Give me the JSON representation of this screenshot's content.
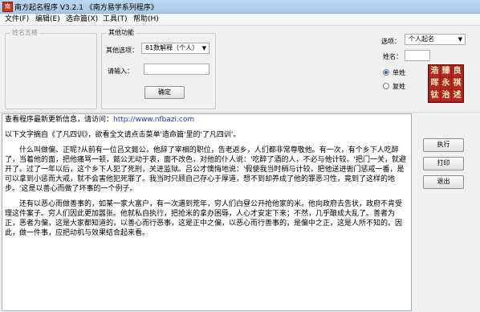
{
  "window": {
    "title": "南方起名程序 V3.2.1  《南方易学系列程序》"
  },
  "menu": {
    "items": [
      "文件(F)",
      "编辑(E)",
      "选命篇(X)",
      "工具(T)",
      "帮助(H)"
    ]
  },
  "surname_group": {
    "caption": "姓名五格"
  },
  "functions_group": {
    "caption": "其他功能",
    "other_option_label": "其他选项：",
    "other_option_value": "81数解释（个人）",
    "input_label": "请输入：",
    "input_value": "",
    "confirm_label": "确定"
  },
  "right_panel": {
    "option_label": "选项：",
    "option_value": "个人起名",
    "surname_label": "姓名：",
    "surname_value": "",
    "radio_single": "单姓",
    "radio_compound": "复姓",
    "selected": "single",
    "logo_chars": [
      "浩",
      "臻",
      "良",
      "晖",
      "永",
      "祺",
      "钛",
      "治",
      "述"
    ]
  },
  "buttons": {
    "execute": "执行",
    "print": "打印",
    "exit": "退出"
  },
  "text": {
    "line1": "查看程序最新更新信息，请访问：",
    "url": "http://www.nfbazi.com",
    "line2": "以下文字摘自《了凡四训》，欲看全文请点击菜单'造命篇'里的'了凡四训'。",
    "para1": "　　什么叫做偏、正呢?从前有一位吕文懿公，他辞了宰相的职位，告老返乡，人们都非常尊敬他。有一次，有个乡下人吃醉了，当着他的面，把他痛骂一顿，懿公无动于衷，面不改色，对他的仆人说：'吃醉了酒的人，不必与他计较。'把门一关，就避开了。过了一年以后，这个乡下人犯了死刑，关进监狱。吕公才懊悔地说：'假使我当时稍与计较，把他送进衙门惩戒一番，是可以拿到小惩而大戒，就不会害他犯死罪了。我当时只顾自己存心于厚道，想不到却养成了他的罪恶习性，竟到了这样的地步。'这是以善心而做了坏事的一个例子。",
    "para2": "　　还有以恶心而做善事的，如某一家大富户，有一次遇到荒年，穷人们白昼公开抢他家的米。他向政府去告状，政府不肯受理这件案子。穷人们因此更加嚣张。他就私自执行，把抢米的拿办困辱，人心才安定下来；不然，几乎酿成大乱了。善者为正，恶者为偏，这是大家都知道的，以善心而行恶事，这是正中之偏，以恶心而行善事的，是偏中之正，这是人所不知的。因此，做一件事，应把动机与效果结合起来看。"
  }
}
